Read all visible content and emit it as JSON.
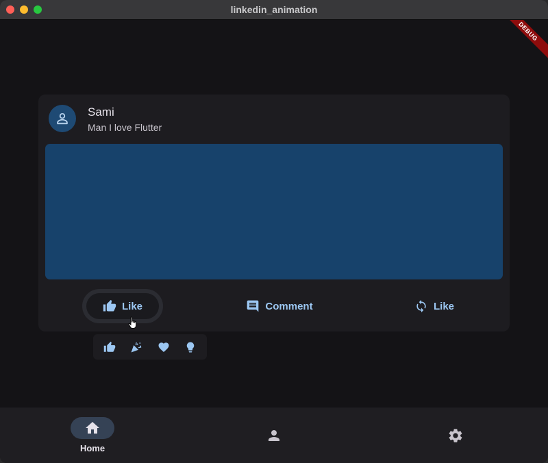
{
  "window": {
    "title": "linkedin_animation",
    "debug_label": "DEBUG"
  },
  "post": {
    "author": "Sami",
    "caption": "Man I love Flutter",
    "avatar_icon": "person-outline-icon",
    "media_color": "#17426b"
  },
  "actions": {
    "like_label": "Like",
    "comment_label": "Comment",
    "repost_label": "Like",
    "like_icon": "thumb-up-icon",
    "comment_icon": "comment-icon",
    "repost_icon": "sync-icon"
  },
  "reactions": [
    {
      "icon": "thumb-up-icon"
    },
    {
      "icon": "celebrate-icon"
    },
    {
      "icon": "heart-icon"
    },
    {
      "icon": "lightbulb-icon"
    }
  ],
  "nav": {
    "items": [
      {
        "label": "Home",
        "icon": "home-icon",
        "selected": true
      },
      {
        "label": "",
        "icon": "person-icon",
        "selected": false
      },
      {
        "label": "",
        "icon": "settings-icon",
        "selected": false
      }
    ]
  },
  "colors": {
    "accent": "#9cc7f2",
    "background": "#141316",
    "card": "#1d1c20"
  }
}
